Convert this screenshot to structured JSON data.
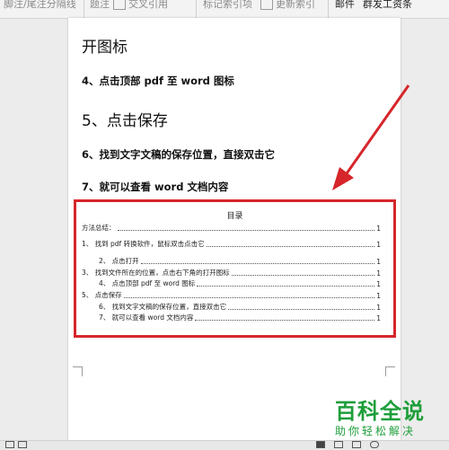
{
  "ribbon": {
    "items": [
      "脚注/尾注分隔线",
      "题注",
      "交叉引用",
      "标记索引项",
      "更新索引",
      "邮件",
      "群发工资条"
    ]
  },
  "document": {
    "line1": "开图标",
    "line2": "4、点击顶部 pdf 至 word 图标",
    "line3": "5、点击保存",
    "line4": "6、找到文字文稿的保存位置，直接双击它",
    "line5": "7、就可以查看 word 文档内容"
  },
  "toc": {
    "title": "目录",
    "entries": [
      {
        "text": "方法总结：",
        "page": "1"
      },
      {
        "text": "1、 找到 pdf 转换软件，鼠标双击点击它",
        "page": "1"
      },
      {
        "text": "2、 点击打开",
        "page": "1"
      },
      {
        "text": "3、 找到文件所在的位置，点击右下角的打开图标",
        "page": "1"
      },
      {
        "text": "4、 点击顶部 pdf 至 word 图标",
        "page": "1"
      },
      {
        "text": "5、 点击保存",
        "page": "1"
      },
      {
        "text": "6、 找到文字文稿的保存位置，直接双击它",
        "page": "1"
      },
      {
        "text": "7、 就可以查看 word 文档内容",
        "page": "1"
      }
    ]
  },
  "watermark": {
    "main": "百科全说",
    "sub": "助你轻松解决"
  },
  "colors": {
    "highlight": "#d6262b",
    "watermark": "#1e9e3a"
  }
}
